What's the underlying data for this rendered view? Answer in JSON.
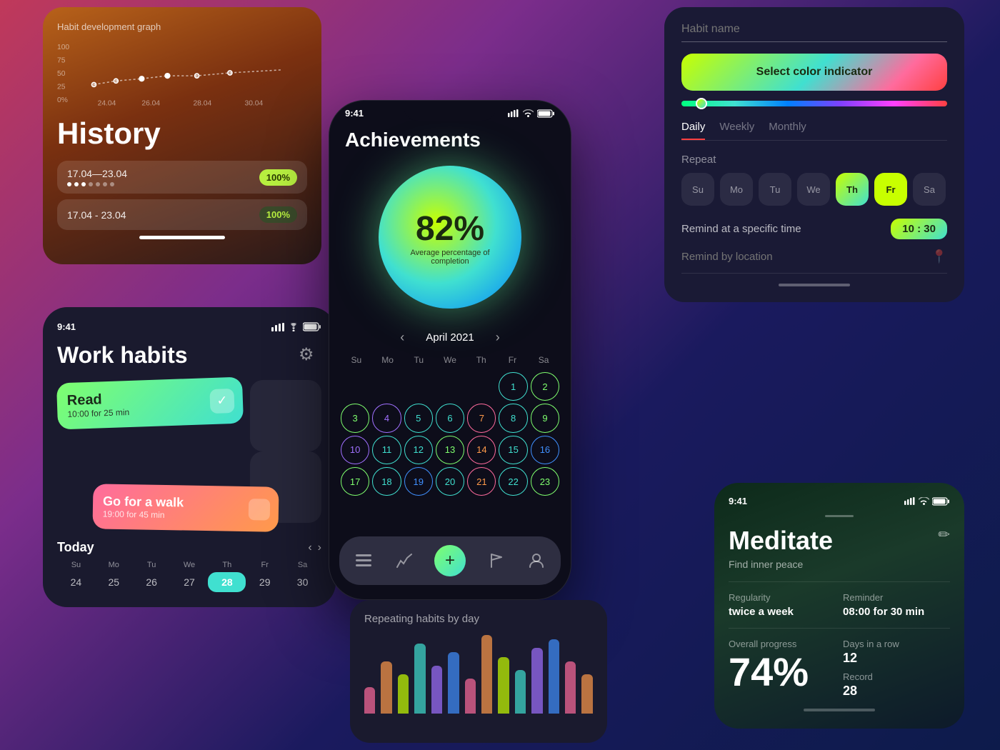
{
  "history": {
    "graph_title": "Habit development graph",
    "title": "History",
    "row1_date": "17.04—23.04",
    "row1_badge": "100%",
    "row2_date": "17.04 - 23.04",
    "row2_badge": "100%",
    "graph_y_labels": [
      "100",
      "75",
      "50",
      "25",
      "0%"
    ],
    "graph_x_labels": [
      "24.04",
      "26.04",
      "28.04",
      "30.04"
    ]
  },
  "work_habits": {
    "time": "9:41",
    "title": "Work habits",
    "today_label": "Today",
    "read_name": "Read",
    "read_time": "10:00 for 25 min",
    "walk_name": "Go for a walk",
    "walk_time": "19:00 for 45 min",
    "week_days": [
      "Su",
      "Mo",
      "Tu",
      "We",
      "Th",
      "Fr",
      "Sa"
    ],
    "week_dates": [
      "24",
      "25",
      "26",
      "27",
      "28",
      "29",
      "30"
    ],
    "today_date": "28"
  },
  "achievements": {
    "time": "9:41",
    "title": "Achievements",
    "percent": "82%",
    "label": "Average percentage of\ncompletion",
    "month": "April 2021",
    "week_headers": [
      "Su",
      "Mo",
      "Tu",
      "We",
      "Th",
      "Fr",
      "Sa"
    ],
    "days": [
      {
        "n": "",
        "ring": "empty"
      },
      {
        "n": "",
        "ring": "empty"
      },
      {
        "n": "",
        "ring": "empty"
      },
      {
        "n": "",
        "ring": "empty"
      },
      {
        "n": "",
        "ring": "empty"
      },
      {
        "n": "1",
        "ring": "ring-teal"
      },
      {
        "n": "2",
        "ring": "ring-green"
      },
      {
        "n": "3",
        "ring": "ring-green"
      },
      {
        "n": "4",
        "ring": "ring-purple"
      },
      {
        "n": "5",
        "ring": "ring-teal"
      },
      {
        "n": "6",
        "ring": "ring-teal"
      },
      {
        "n": "7",
        "ring": "ring-pink"
      },
      {
        "n": "8",
        "ring": "ring-teal"
      },
      {
        "n": "9",
        "ring": "ring-green"
      },
      {
        "n": "10",
        "ring": "ring-purple"
      },
      {
        "n": "11",
        "ring": "ring-teal"
      },
      {
        "n": "12",
        "ring": "ring-teal"
      },
      {
        "n": "13",
        "ring": "ring-green"
      },
      {
        "n": "14",
        "ring": "ring-pink"
      },
      {
        "n": "15",
        "ring": "ring-teal"
      },
      {
        "n": "16",
        "ring": "ring-blue"
      },
      {
        "n": "17",
        "ring": "ring-green"
      },
      {
        "n": "18",
        "ring": "ring-teal"
      },
      {
        "n": "19",
        "ring": "ring-blue"
      },
      {
        "n": "20",
        "ring": "ring-teal"
      },
      {
        "n": "21",
        "ring": "ring-pink"
      },
      {
        "n": "22",
        "ring": "ring-teal"
      },
      {
        "n": "23",
        "ring": "ring-green"
      }
    ],
    "nav_icons": [
      "list",
      "chart",
      "add",
      "flag",
      "person"
    ]
  },
  "settings": {
    "habit_name_placeholder": "Habit name",
    "color_btn_label": "Select color indicator",
    "tabs": [
      "Daily",
      "Weekly",
      "Monthly"
    ],
    "active_tab": "Daily",
    "repeat_label": "Repeat",
    "days": [
      "Su",
      "Mo",
      "Tu",
      "We",
      "Th",
      "Fr",
      "Sa"
    ],
    "active_days": [
      "Th",
      "Fr"
    ],
    "remind_time_label": "Remind at a specific time",
    "time_value": "10 : 30",
    "remind_location_label": "Remind by location"
  },
  "meditate": {
    "time": "9:41",
    "title": "Meditate",
    "subtitle": "Find inner peace",
    "edit_icon": "✏",
    "regularity_label": "Regularity",
    "regularity_value": "twice a week",
    "reminder_label": "Reminder",
    "reminder_value": "08:00 for 30 min",
    "progress_label": "Overall progress",
    "progress_value": "74%",
    "days_label": "Days in a row",
    "days_value": "12",
    "record_label": "Record",
    "record_value": "28"
  },
  "repeating": {
    "title": "Repeating habits by day",
    "bars": [
      30,
      60,
      45,
      80,
      55,
      70,
      40,
      90,
      65,
      50,
      75,
      85,
      60,
      45
    ]
  }
}
